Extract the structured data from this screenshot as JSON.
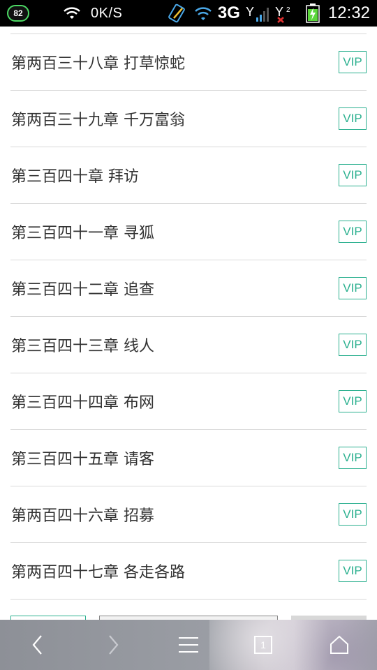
{
  "status_bar": {
    "battery_level": "82",
    "net_speed": "0K/S",
    "network_type": "3G",
    "time": "12:32",
    "icons": [
      "wifi-icon",
      "compass-icon",
      "wifi-alt-icon",
      "signal-icon",
      "signal-2-icon",
      "battery-charging-icon"
    ]
  },
  "chapters": [
    {
      "title": "第两百三十八章 打草惊蛇",
      "badge": "VIP"
    },
    {
      "title": "第两百三十九章 千万富翁",
      "badge": "VIP"
    },
    {
      "title": "第三百四十章 拜访",
      "badge": "VIP"
    },
    {
      "title": "第三百四十一章 寻狐",
      "badge": "VIP"
    },
    {
      "title": "第三百四十二章 追查",
      "badge": "VIP"
    },
    {
      "title": "第三百四十三章 线人",
      "badge": "VIP"
    },
    {
      "title": "第三百四十四章 布网",
      "badge": "VIP"
    },
    {
      "title": "第三百四十五章 请客",
      "badge": "VIP"
    },
    {
      "title": "第两百四十六章 招募",
      "badge": "VIP"
    },
    {
      "title": "第两百四十七章 各走各路",
      "badge": "VIP"
    }
  ],
  "colors": {
    "accent": "#2bb08f",
    "divider": "#d9d9d9",
    "text": "#333333",
    "status_bar_bg": "#000000"
  },
  "nav_bar": {
    "items": [
      "back-icon",
      "forward-icon",
      "menu-icon",
      "tabs-icon",
      "home-icon"
    ],
    "tab_count": "1"
  }
}
